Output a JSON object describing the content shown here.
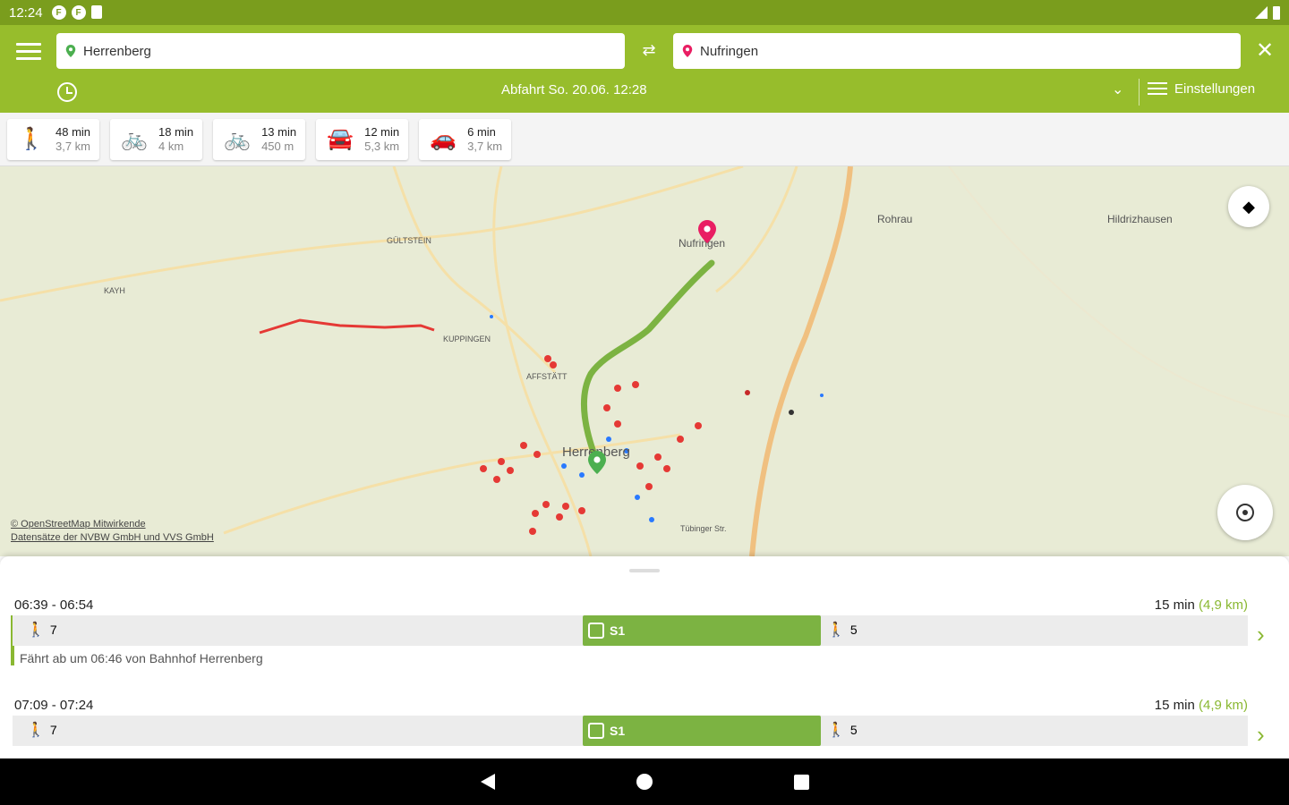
{
  "status_bar": {
    "time": "12:24",
    "notif_icons": [
      "F",
      "F"
    ]
  },
  "header": {
    "from": "Herrenberg",
    "to": "Nufringen",
    "departure": "Abfahrt  So. 20.06.  12:28",
    "settings_label": "Einstellungen",
    "swap_icon": "swap-icon",
    "close_icon": "close-icon"
  },
  "modes": [
    {
      "icon": "walk-icon",
      "duration": "48 min",
      "distance": "3,7 km"
    },
    {
      "icon": "bike-icon",
      "duration": "18 min",
      "distance": "4 km"
    },
    {
      "icon": "bike-share-icon",
      "duration": "13 min",
      "distance": "450 m"
    },
    {
      "icon": "car-share-icon",
      "duration": "12 min",
      "distance": "5,3 km"
    },
    {
      "icon": "car-icon",
      "duration": "6 min",
      "distance": "3,7 km"
    }
  ],
  "map": {
    "labels": {
      "nufringen": "Nufringen",
      "rohrau": "Rohrau",
      "hildrizhausen": "Hildrizhausen",
      "herrenberg": "Herrenberg",
      "gueltstein": "GÜLTSTEIN",
      "kayh": "KAYH",
      "affstaett": "AFFSTÄTT",
      "kuppingen": "KUPPINGEN",
      "gueltstein_road": "Tübinger Str."
    },
    "attribution_1": "© OpenStreetMap Mitwirkende",
    "attribution_2": "Datensätze der NVBW GmbH und VVS GmbH"
  },
  "trips": [
    {
      "time": "06:39 - 06:54",
      "duration": "15 min",
      "distance": "(4,9 km)",
      "walk_before": "7",
      "line": "S1",
      "walk_after": "5",
      "note": "Fährt ab um 06:46 von Bahnhof Herrenberg"
    },
    {
      "time": "07:09 - 07:24",
      "duration": "15 min",
      "distance": "(4,9 km)",
      "walk_before": "7",
      "line": "S1",
      "walk_after": "5",
      "note": ""
    }
  ],
  "colors": {
    "primary": "#97bd2c",
    "statusbar": "#7a9d1d",
    "train": "#7cb342",
    "route": "#7cb342"
  }
}
